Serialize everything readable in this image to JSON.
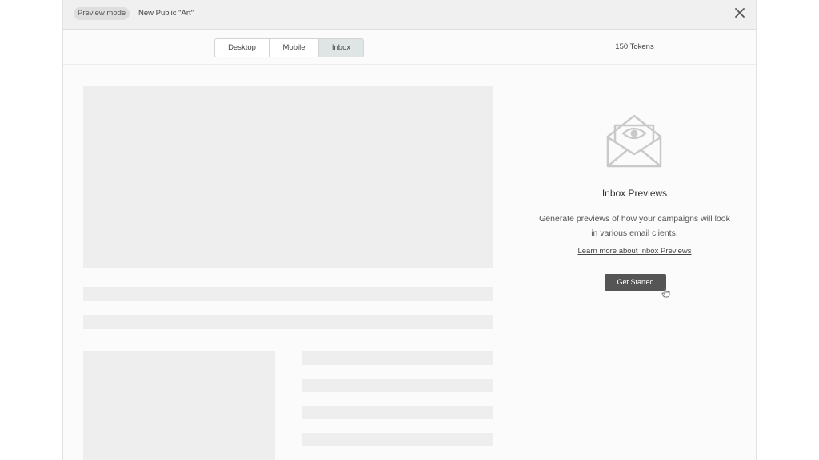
{
  "header": {
    "mode_badge": "Preview mode",
    "campaign_title": "New Public \"Art\"",
    "close_icon": "close-icon"
  },
  "view_tabs": [
    {
      "label": "Desktop",
      "active": false
    },
    {
      "label": "Mobile",
      "active": false
    },
    {
      "label": "Inbox",
      "active": true
    }
  ],
  "tokens": {
    "label": "150 Tokens"
  },
  "inbox_panel": {
    "icon": "envelope-eye-icon",
    "title": "Inbox Previews",
    "description": "Generate previews of how your campaigns will look in various email clients.",
    "learn_more": "Learn more about Inbox Previews",
    "cta": "Get Started"
  },
  "colors": {
    "placeholder": "#eeeeee",
    "button_bg": "#555555",
    "active_tab": "#dfe4e4"
  }
}
